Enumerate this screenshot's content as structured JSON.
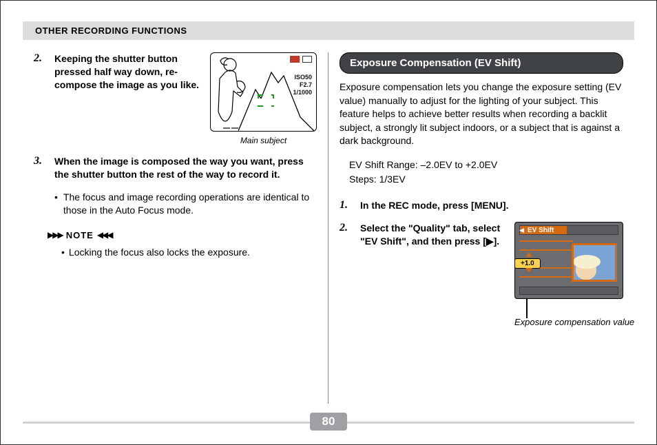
{
  "header": {
    "title": "OTHER RECORDING FUNCTIONS"
  },
  "left": {
    "step2": {
      "num": "2.",
      "text": "Keeping the shutter button pressed half way down, re-compose the image as you like."
    },
    "illustration": {
      "stats": {
        "iso": "ISO50",
        "f": "F2.7",
        "shutter": "1/1000"
      },
      "caption": "Main subject"
    },
    "step3": {
      "num": "3.",
      "text": "When the image is composed the way you want, press the shutter button the rest of the way to record it."
    },
    "step3_bullet": "The focus and image recording operations are identical to those in the Auto Focus mode.",
    "note_label": "NOTE",
    "note_bullet": "Locking the focus also locks the exposure."
  },
  "right": {
    "section_title": "Exposure Compensation (EV Shift)",
    "intro": "Exposure compensation lets you change the exposure setting (EV value) manually to adjust for the lighting of your subject. This feature helps to achieve better results when recording a backlit subject, a strongly lit subject indoors, or a subject that is against a dark background.",
    "specs": {
      "range": "EV Shift Range: –2.0EV to +2.0EV",
      "steps": "Steps: 1/3EV"
    },
    "step1": {
      "num": "1.",
      "text": "In the REC mode, press [MENU]."
    },
    "step2": {
      "num": "2.",
      "text": "Select the \"Quality\" tab, select \"EV Shift\", and then press [▶]."
    },
    "lcd": {
      "tab_label": "EV Shift",
      "value": "+1.0",
      "caption": "Exposure compensation value"
    }
  },
  "page_number": "80"
}
